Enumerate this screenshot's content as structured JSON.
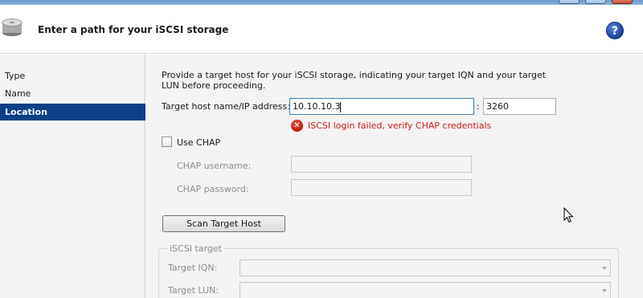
{
  "header": {
    "title": "Enter a path for your iSCSI storage",
    "help_glyph": "?"
  },
  "nav": {
    "items": [
      {
        "label": "Type",
        "active": false
      },
      {
        "label": "Name",
        "active": false
      },
      {
        "label": "Location",
        "active": true
      }
    ]
  },
  "main": {
    "description": "Provide a target host for your iSCSI storage, indicating your target IQN and your target LUN before proceeding.",
    "target_host_label": "Target host name/IP address:",
    "target_host_value": "10.10.10.3",
    "port_separator": ":",
    "port_value": "3260",
    "error_message": "ISCSI login failed, verify CHAP credentials",
    "use_chap_label": "Use CHAP",
    "use_chap_checked": false,
    "chap_username_label": "CHAP username:",
    "chap_username_value": "",
    "chap_password_label": "CHAP password:",
    "chap_password_value": "",
    "scan_button_label": "Scan Target Host",
    "iscsi_target_group_label": "iSCSI target",
    "target_iqn_label": "Target IQN:",
    "target_iqn_value": "",
    "target_lun_label": "Target LUN:",
    "target_lun_value": ""
  },
  "colors": {
    "selection": "#0c3f86",
    "error": "#d11a1a",
    "panel": "#f3f3f3"
  },
  "icons": {
    "header": "storage-disk-icon",
    "help": "help-icon",
    "error": "error-icon",
    "dropdown": "chevron-down-icon",
    "pointer": "mouse-cursor-icon"
  }
}
